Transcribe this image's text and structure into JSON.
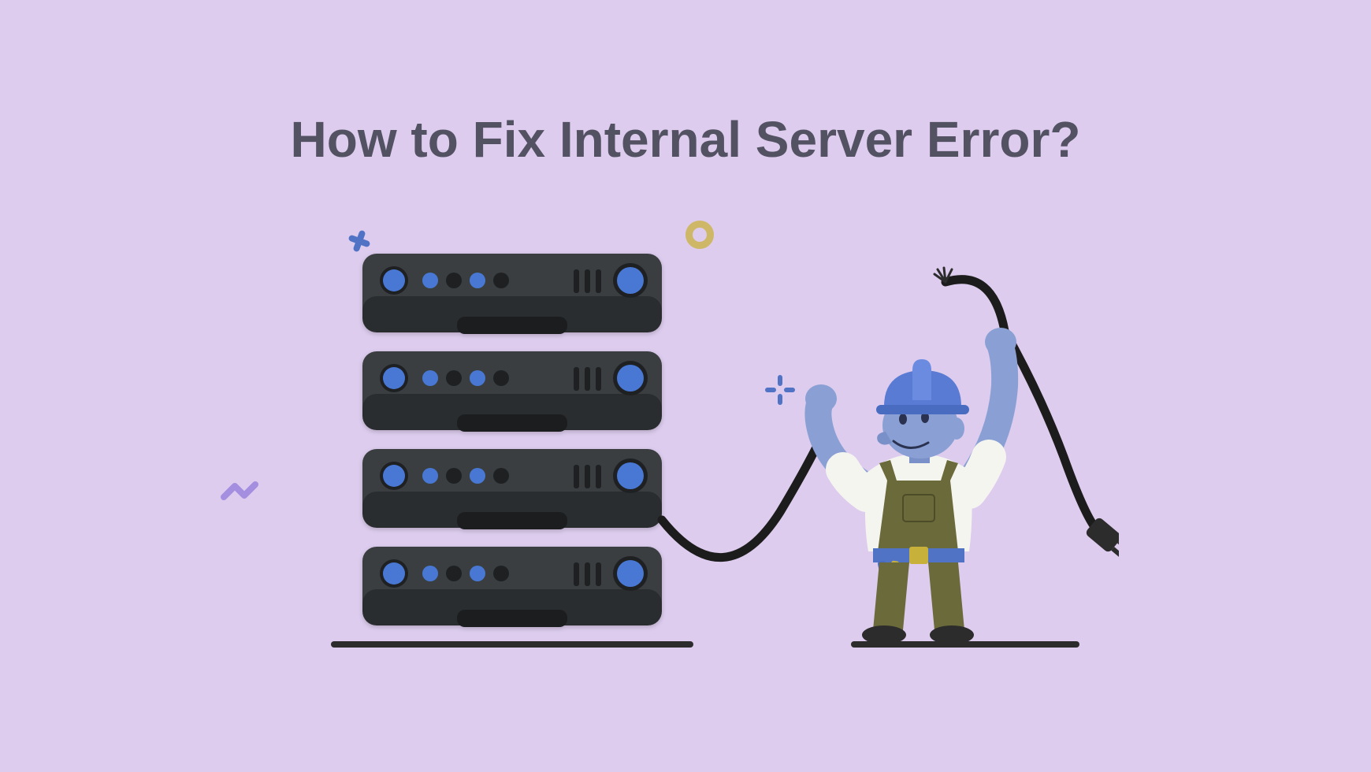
{
  "heading": "How to Fix Internal Server Error?",
  "illustration": {
    "server_units": 4,
    "colors": {
      "background": "#ddccee",
      "server_body": "#3a3e40",
      "server_shadow": "#2a2d2f",
      "led_blue": "#4878d4",
      "led_dark": "#1e2022",
      "skin": "#8aa0d4",
      "helmet": "#5a7bd4",
      "shirt": "#f5f5f0",
      "overalls": "#6b6a3a",
      "belt": "#5173c5",
      "accent_yellow": "#c8b13a",
      "accent_purple": "#a48ee0"
    }
  }
}
